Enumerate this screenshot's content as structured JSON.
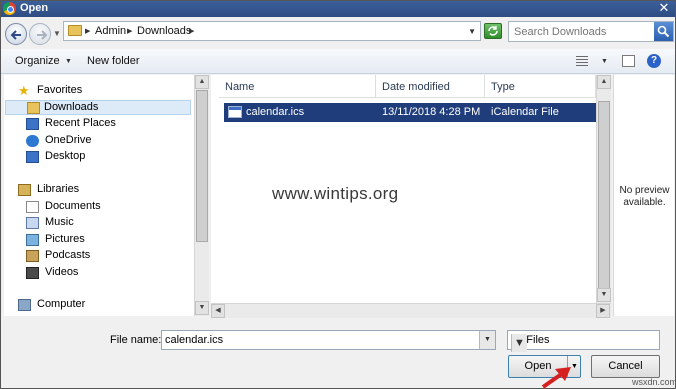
{
  "window": {
    "title": "Open"
  },
  "address": {
    "crumbs": [
      "Admin",
      "Downloads"
    ]
  },
  "search": {
    "placeholder": "Search Downloads"
  },
  "toolbar": {
    "organize": "Organize",
    "new_folder": "New folder",
    "help": "?"
  },
  "nav": {
    "favorites": "Favorites",
    "favorites_items": [
      "Downloads",
      "Recent Places",
      "OneDrive",
      "Desktop"
    ],
    "libraries": "Libraries",
    "libraries_items": [
      "Documents",
      "Music",
      "Pictures",
      "Podcasts",
      "Videos"
    ],
    "computer": "Computer"
  },
  "columns": [
    "Name",
    "Date modified",
    "Type"
  ],
  "files": [
    {
      "name": "calendar.ics",
      "date": "13/11/2018 4:28 PM",
      "type": "iCalendar File"
    }
  ],
  "watermark": "www.wintips.org",
  "preview": {
    "line1": "No preview",
    "line2": "available."
  },
  "bottom": {
    "file_name_label": "File name:",
    "file_name_value": "calendar.ics",
    "file_type": "All Files",
    "open": "Open",
    "cancel": "Cancel"
  },
  "corner_mark": "wsxdn.com",
  "colors": {
    "titlebar": "#2e4c82",
    "selection": "#1f3d7a",
    "arrow": "#d62020"
  }
}
